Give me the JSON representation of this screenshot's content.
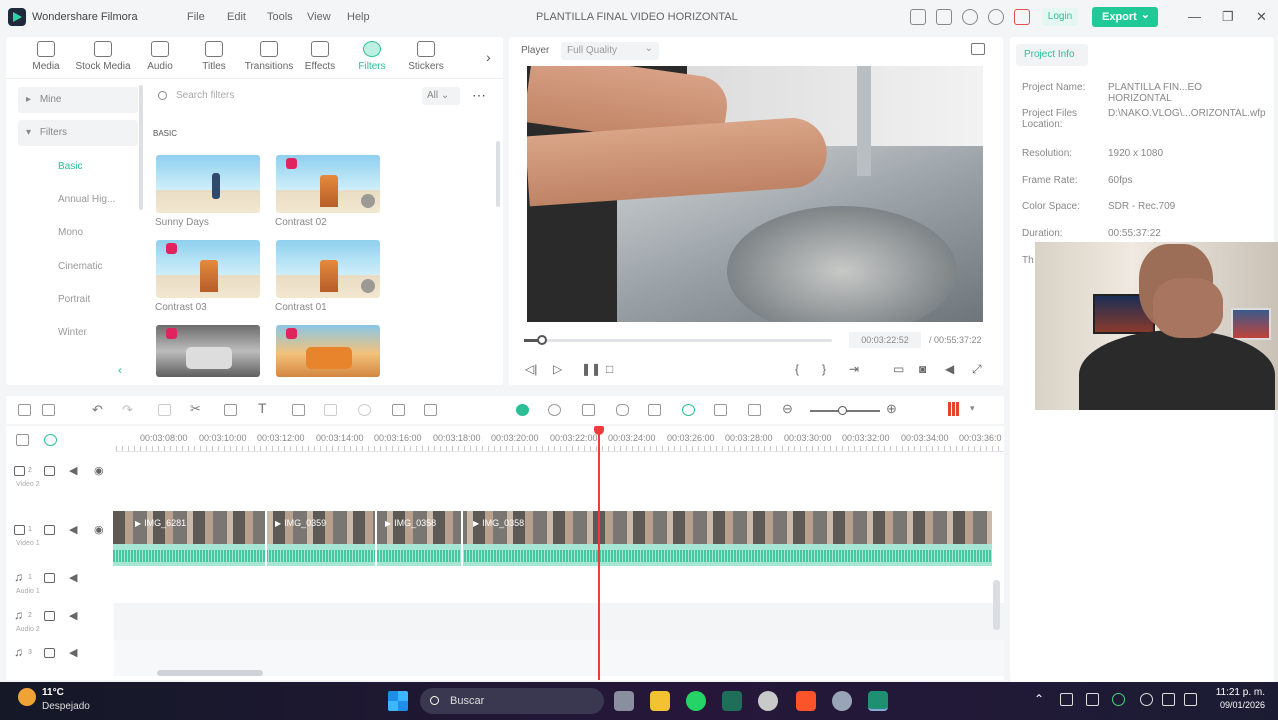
{
  "titlebar": {
    "app_name": "Wondershare Filmora",
    "menu": [
      "File",
      "Edit",
      "Tools",
      "View",
      "Help"
    ],
    "project_title": "PLANTILLA FINAL VIDEO HORIZONTAL",
    "login_label": "Login",
    "export_label": "Export"
  },
  "media_tabs": [
    "Media",
    "Stock Media",
    "Audio",
    "Titles",
    "Transitions",
    "Effects",
    "Filters",
    "Stickers"
  ],
  "active_tab": "Filters",
  "sidebar": {
    "mine": "Mine",
    "filters": "Filters",
    "items": [
      "Basic",
      "Annual Hig...",
      "Mono",
      "Cinematic",
      "Portrait",
      "Winter"
    ],
    "active_item": "Basic"
  },
  "search": {
    "placeholder": "Search filters",
    "filter_value": "All"
  },
  "section_label": "BASIC",
  "filters": [
    {
      "name": "Sunny Days"
    },
    {
      "name": "Contrast 02"
    },
    {
      "name": "Contrast 03"
    },
    {
      "name": "Contrast 01"
    }
  ],
  "player": {
    "label": "Player",
    "quality": "Full Quality",
    "current_time": "00:03:22:52",
    "total_time": "/ 00:55:37:22",
    "progress": 0.06
  },
  "project_info": {
    "tab": "Project Info",
    "rows": [
      {
        "label": "Project Name:",
        "value": "PLANTILLA FIN...EO HORIZONTAL"
      },
      {
        "label": "Project Files Location:",
        "value": "D:\\NAKO.VLOG\\...ORIZONTAL.wfp"
      },
      {
        "label": "Resolution:",
        "value": "1920 x 1080"
      },
      {
        "label": "Frame Rate:",
        "value": "60fps"
      },
      {
        "label": "Color Space:",
        "value": "SDR - Rec.709"
      },
      {
        "label": "Duration:",
        "value": "00:55:37:22"
      },
      {
        "label": "Th",
        "value": ""
      }
    ]
  },
  "ruler": [
    "00:03:08:00",
    "00:03:10:00",
    "00:03:12:00",
    "00:03:14:00",
    "00:03:16:00",
    "00:03:18:00",
    "00:03:20:00",
    "00:03:22:00",
    "00:03:24:00",
    "00:03:26:00",
    "00:03:28:00",
    "00:03:30:00",
    "00:03:32:00",
    "00:03:34:00",
    "00:03:36:0"
  ],
  "tracks": {
    "video2": "Video 2",
    "video1": "Video 1",
    "audio1": "Audio 1",
    "audio2": "Audio 2",
    "v2_num": "2",
    "v1_num": "1",
    "a1_num": "1",
    "a2_num": "2",
    "a3_num": "3"
  },
  "clips": [
    "IMG_6281",
    "IMG_0359",
    "IMG_0358",
    "IMG_0358"
  ],
  "taskbar": {
    "temp": "11°C",
    "weather": "Despejado",
    "search": "Buscar",
    "time": "11:21 p. m.",
    "date": "09/01/2026"
  }
}
